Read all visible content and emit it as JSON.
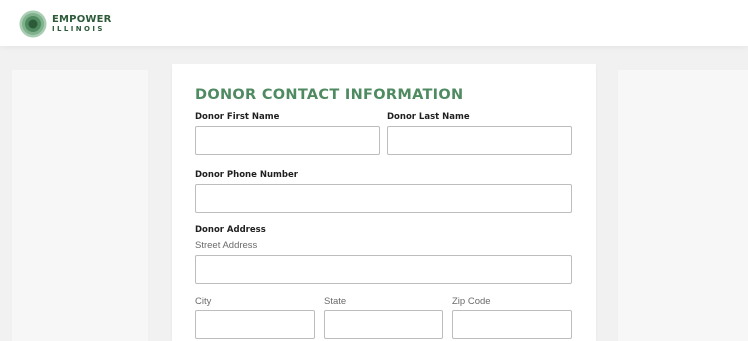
{
  "header": {
    "logo_line1": "EMPOWER",
    "logo_line2": "ILLINOIS"
  },
  "form": {
    "title": "DONOR CONTACT INFORMATION",
    "first_name": {
      "label": "Donor First Name",
      "value": ""
    },
    "last_name": {
      "label": "Donor Last Name",
      "value": ""
    },
    "phone": {
      "label": "Donor Phone Number",
      "value": ""
    },
    "address": {
      "label": "Donor Address",
      "street": {
        "label": "Street Address",
        "value": ""
      },
      "city": {
        "label": "City",
        "value": ""
      },
      "state": {
        "label": "State",
        "value": ""
      },
      "zip": {
        "label": "Zip Code",
        "value": ""
      }
    }
  },
  "colors": {
    "brand_green": "#4f8a61",
    "logo_dark_green": "#2d5b3a",
    "page_background": "#f1f1f1"
  }
}
